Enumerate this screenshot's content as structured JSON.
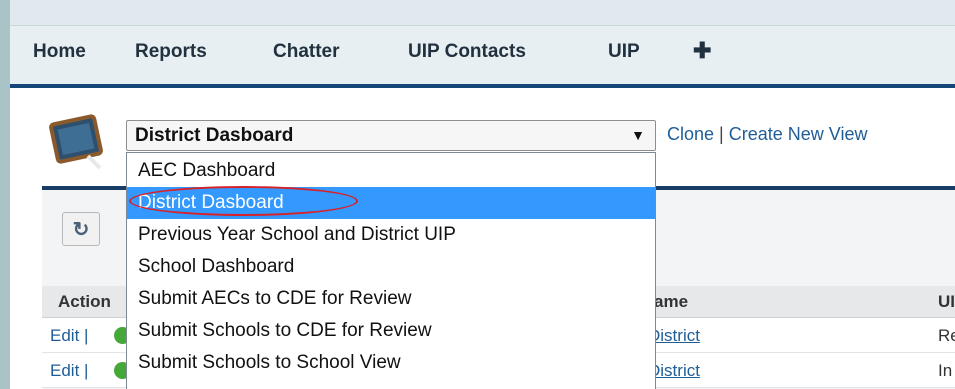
{
  "nav": {
    "items": [
      "Home",
      "Reports",
      "Chatter",
      "UIP Contacts",
      "UIP"
    ],
    "plus": "✚"
  },
  "view": {
    "selected": "District Dasboard",
    "arrow": "▼",
    "clone": "Clone",
    "separator": "|",
    "create_new": "Create New View",
    "options": [
      "AEC Dashboard",
      "District Dasboard",
      "Previous Year School and District UIP",
      "School Dashboard",
      "Submit AECs to CDE for Review",
      "Submit Schools to CDE for Review",
      "Submit Schools to School View"
    ],
    "selected_index": 1
  },
  "toolbar": {
    "refresh_icon": "↻"
  },
  "table": {
    "headers": [
      "Action",
      "ame",
      "UI"
    ],
    "rows": [
      {
        "action": "Edit |",
        "name": "District",
        "ui": "Re"
      },
      {
        "action": "Edit |",
        "name": "District",
        "ui": "In"
      }
    ]
  },
  "colors": {
    "nav_border": "#15467a",
    "link": "#1f5d97",
    "selection": "#3399ff",
    "annotation": "#d6232a"
  }
}
